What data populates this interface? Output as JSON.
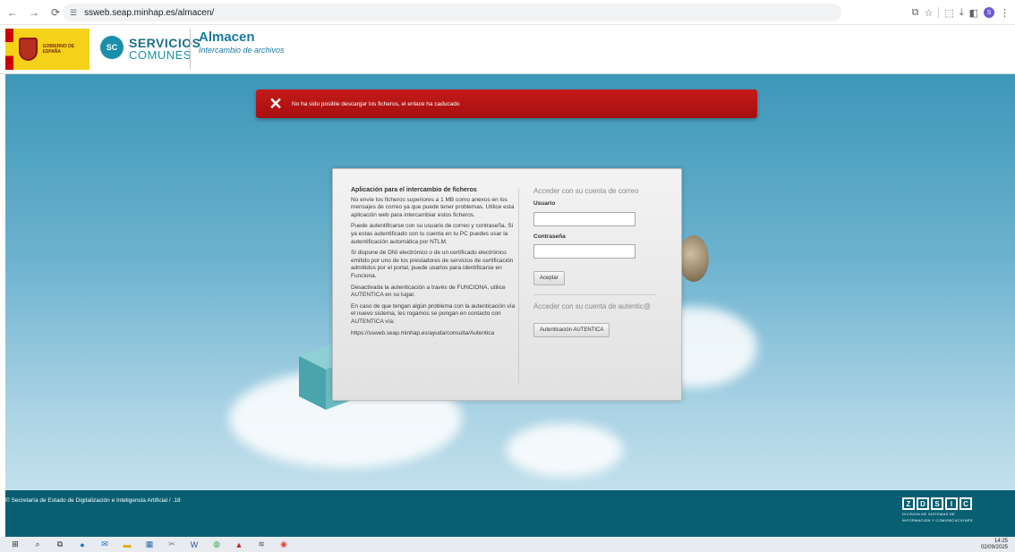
{
  "browser": {
    "url": "ssweb.seap.minhap.es/almacen/",
    "profile_initial": "S"
  },
  "header": {
    "gob_logo_text": "GOBIERNO DE ESPAÑA",
    "sc_line1": "SERVICIOS",
    "sc_line2": "COMUNES",
    "sc_badge": "SC",
    "title": "Almacen",
    "subtitle": "Intercambio de archivos"
  },
  "error": {
    "message": "No ha sido posible descargar los ficheros, el enlace ha caducado"
  },
  "panel": {
    "info_title": "Aplicación para el intercambio de ficheros",
    "info_paragraphs": [
      "No envíe los ficheros superiores a 1 MB como anexos en los mensajes de correo ya que puede tener problemas. Utilice esta aplicación web para intercambiar estos ficheros.",
      "Puede autentificarse con su usuario de correo y contraseña. Si ya estas autentificado con tu cuenta en tu PC puedes usar la autentificación automática por NTLM.",
      "Si dispone de DNI electrónico o de un certificado electrónico emitido por uno de los prestadores de servicios de certificación admitidos por el portal, puede usarlos para identificarse en Funciona.",
      "Desactivada la autenticación a través de FUNCIONA, utilice AUTENTICA en su lugar.",
      "En caso de que tengan algún problema con la autenticación vía el nuevo sistema, les rogamos se pongan en contacto con AUTENTICA vía:",
      "https://ssweb.seap.minhap.es/ayuda/consulta/Autentica"
    ],
    "mail_section_title": "Acceder con su cuenta de correo",
    "user_label": "Usuario",
    "user_value": "",
    "password_label": "Contraseña",
    "password_value": "",
    "accept_button": "Aceptar",
    "autentica_section_title": "Acceder con su cuenta de autentic@",
    "autentica_button": "Autenticación AUTENTICA"
  },
  "footer": {
    "copyright": "© Secretaría de Estado de Digitalización e Inteligencia Artificial / .18",
    "dsic_letters": [
      "Z",
      "D",
      "S",
      "I",
      "C"
    ],
    "dsic_sub1": "DIVISION DE SISTEMAS DE",
    "dsic_sub2": "INFORMACION Y COMUNICACIONES"
  },
  "taskbar": {
    "time": "14:25",
    "date": "02/09/2025"
  }
}
